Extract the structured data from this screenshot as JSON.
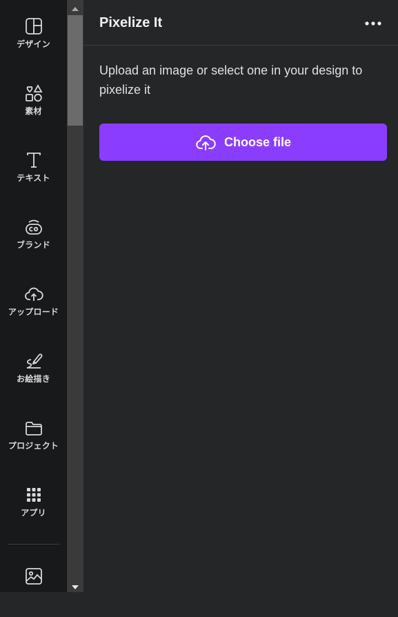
{
  "sidebar": {
    "items": [
      {
        "label": "デザイン",
        "icon": "layout-icon"
      },
      {
        "label": "素材",
        "icon": "elements-icon"
      },
      {
        "label": "テキスト",
        "icon": "text-icon"
      },
      {
        "label": "ブランド",
        "icon": "brand-icon"
      },
      {
        "label": "アップロード",
        "icon": "upload-cloud-icon"
      },
      {
        "label": "お絵描き",
        "icon": "draw-icon"
      },
      {
        "label": "プロジェクト",
        "icon": "folder-icon"
      },
      {
        "label": "アプリ",
        "icon": "apps-grid-icon"
      }
    ],
    "bottom_icon": "image-icon"
  },
  "panel": {
    "title": "Pixelize It",
    "description": "Upload an image or select one in your design to pixelize it",
    "choose_file_label": "Choose file",
    "more_icon": "more-horizontal-icon",
    "upload_icon": "cloud-upload-icon"
  },
  "colors": {
    "accent": "#8b3dff",
    "rail_bg": "#18191b",
    "panel_bg": "#252627"
  }
}
